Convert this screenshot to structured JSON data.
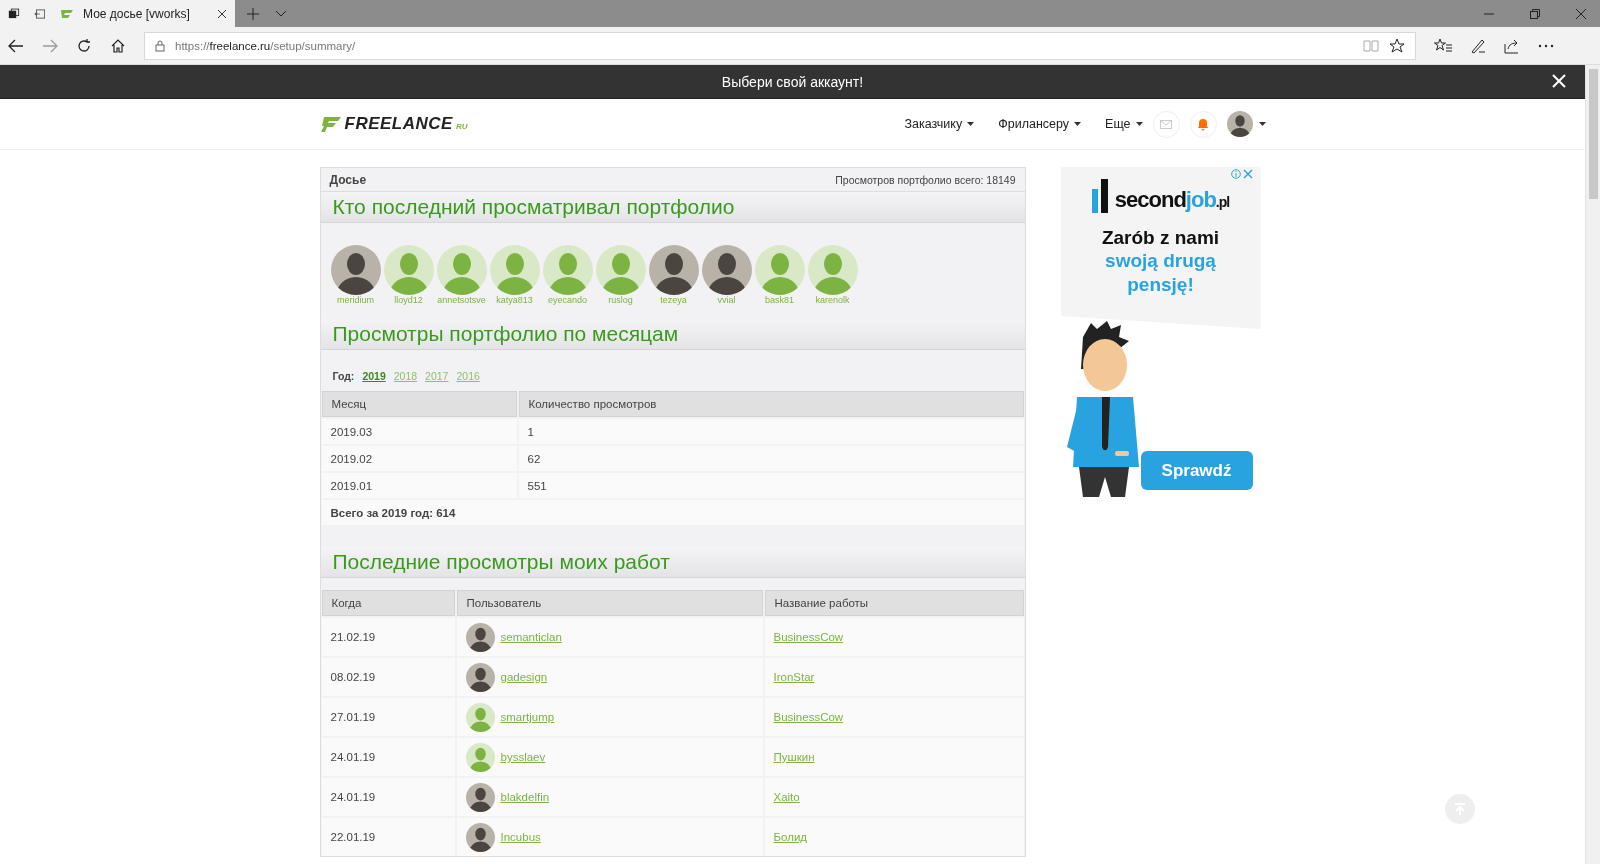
{
  "browser": {
    "tab_title": "Мое досье [vworks]",
    "url": {
      "scheme": "https://",
      "host": "freelance.ru",
      "path": "/setup/summary/"
    }
  },
  "banner": {
    "text": "Выбери свой аккаунт!"
  },
  "header": {
    "logo": "FREELANCE",
    "logo_suffix": "RU",
    "nav": [
      {
        "label": "Заказчику"
      },
      {
        "label": "Фрилансеру"
      },
      {
        "label": "Еще"
      }
    ]
  },
  "dossier": {
    "title": "Досье",
    "views_total": "Просмотров портфолио всего: 18149"
  },
  "recent_viewers": {
    "heading": "Кто последний просматривал портфолио",
    "users": [
      {
        "name": "meridium",
        "kind": "photo"
      },
      {
        "name": "lloyd12",
        "kind": "default"
      },
      {
        "name": "annetsotsve",
        "kind": "default"
      },
      {
        "name": "katya813",
        "kind": "default"
      },
      {
        "name": "eyecando",
        "kind": "default"
      },
      {
        "name": "ruslog",
        "kind": "default"
      },
      {
        "name": "tezeya",
        "kind": "photo"
      },
      {
        "name": "vvial",
        "kind": "photo"
      },
      {
        "name": "bask81",
        "kind": "default"
      },
      {
        "name": "karenolk",
        "kind": "default"
      }
    ]
  },
  "monthly": {
    "heading": "Просмотры портфолио по месяцам",
    "year_label": "Год:",
    "years": [
      {
        "label": "2019",
        "selected": true
      },
      {
        "label": "2018",
        "selected": false
      },
      {
        "label": "2017",
        "selected": false
      },
      {
        "label": "2016",
        "selected": false
      }
    ],
    "columns": [
      "Месяц",
      "Количество просмотров"
    ],
    "rows": [
      [
        "2019.03",
        "1"
      ],
      [
        "2019.02",
        "62"
      ],
      [
        "2019.01",
        "551"
      ]
    ],
    "total": "Всего за 2019 год: 614"
  },
  "works": {
    "heading": "Последние просмотры моих работ",
    "columns": [
      "Когда",
      "Пользователь",
      "Название работы"
    ],
    "rows": [
      {
        "when": "21.02.19",
        "user": "semanticlan",
        "kind": "photo",
        "work": "BusinessCow"
      },
      {
        "when": "08.02.19",
        "user": "gadesign",
        "kind": "photo",
        "work": "IronStar"
      },
      {
        "when": "27.01.19",
        "user": "smartjump",
        "kind": "default",
        "work": "BusinessCow"
      },
      {
        "when": "24.01.19",
        "user": "bysslaev",
        "kind": "default",
        "work": "Пушкин"
      },
      {
        "when": "24.01.19",
        "user": "blakdelfin",
        "kind": "photo",
        "work": "Xaito"
      },
      {
        "when": "22.01.19",
        "user": "Incubus",
        "kind": "photo",
        "work": "Болид"
      }
    ]
  },
  "ad": {
    "brand": {
      "first": "second",
      "middle": "job",
      "last": ".pl"
    },
    "headline": "Zarób z nami",
    "tagline": "swoją drugą pensję!",
    "button": "Sprawdź"
  }
}
